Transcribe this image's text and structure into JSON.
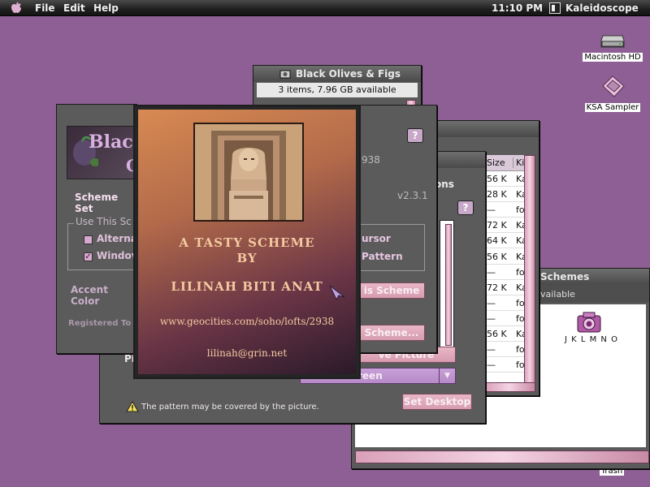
{
  "menubar": {
    "menus": [
      "File",
      "Edit",
      "Help"
    ],
    "clock": "11:10 PM",
    "app_name": "Kaleidoscope"
  },
  "desktop": {
    "icons": [
      {
        "label": "Macintosh HD",
        "icon": "hard-drive-icon"
      },
      {
        "label": "KSA Sampler",
        "icon": "disk-icon"
      },
      {
        "label": "Trash",
        "icon": "trash-icon"
      }
    ]
  },
  "folder_window": {
    "title": "Black Olives & Figs",
    "info": "3 items, 7.96 GB available"
  },
  "list_window": {
    "headers": [
      "Size",
      "Ki"
    ],
    "rows": [
      {
        "size": "56 K",
        "kind": "Ka"
      },
      {
        "size": "28 K",
        "kind": "Ka"
      },
      {
        "size": "—",
        "kind": "fol"
      },
      {
        "size": "72 K",
        "kind": "Ka"
      },
      {
        "size": "64 K",
        "kind": "Ka"
      },
      {
        "size": "56 K",
        "kind": "Ka"
      },
      {
        "size": "—",
        "kind": "fol"
      },
      {
        "size": "72 K",
        "kind": "Ka"
      },
      {
        "size": "—",
        "kind": "fol"
      },
      {
        "size": "—",
        "kind": "fol"
      },
      {
        "size": "56 K",
        "kind": "Ka"
      },
      {
        "size": "—",
        "kind": "fol"
      },
      {
        "size": "—",
        "kind": "fol"
      }
    ]
  },
  "schemes_window": {
    "title": "Schemes",
    "info": "vailable",
    "item_label": "J K L M N O"
  },
  "prefs_window": {
    "logo_text": "Black",
    "logo_sub": "O",
    "scheme_label": "Scheme Set",
    "use_group": "Use This Sc",
    "check1": "Alterna",
    "check2": "Windov",
    "accent": "Accent Color",
    "registered": "Registered To"
  },
  "mid_window": {
    "number": "938",
    "version": "v2.3.1",
    "cursor_label": "ursor",
    "pattern_label": "Pattern",
    "scheme_btn": "is Scheme",
    "scheme2_btn": "Scheme..."
  },
  "desktop_window": {
    "title_frag": "ons",
    "picture_btn": "ve Picture",
    "screen_select": "reen",
    "set_desktop": "Set Desktop",
    "p_label": "Pi",
    "warning": "The pattern may be covered by the picture."
  },
  "splash": {
    "line1": "A TASTY SCHEME",
    "line2": "BY",
    "line3": "LILINAH BITI ANAT",
    "url": "www.geocities.com/soho/lofts/2938",
    "email": "lilinah@grin.net"
  }
}
